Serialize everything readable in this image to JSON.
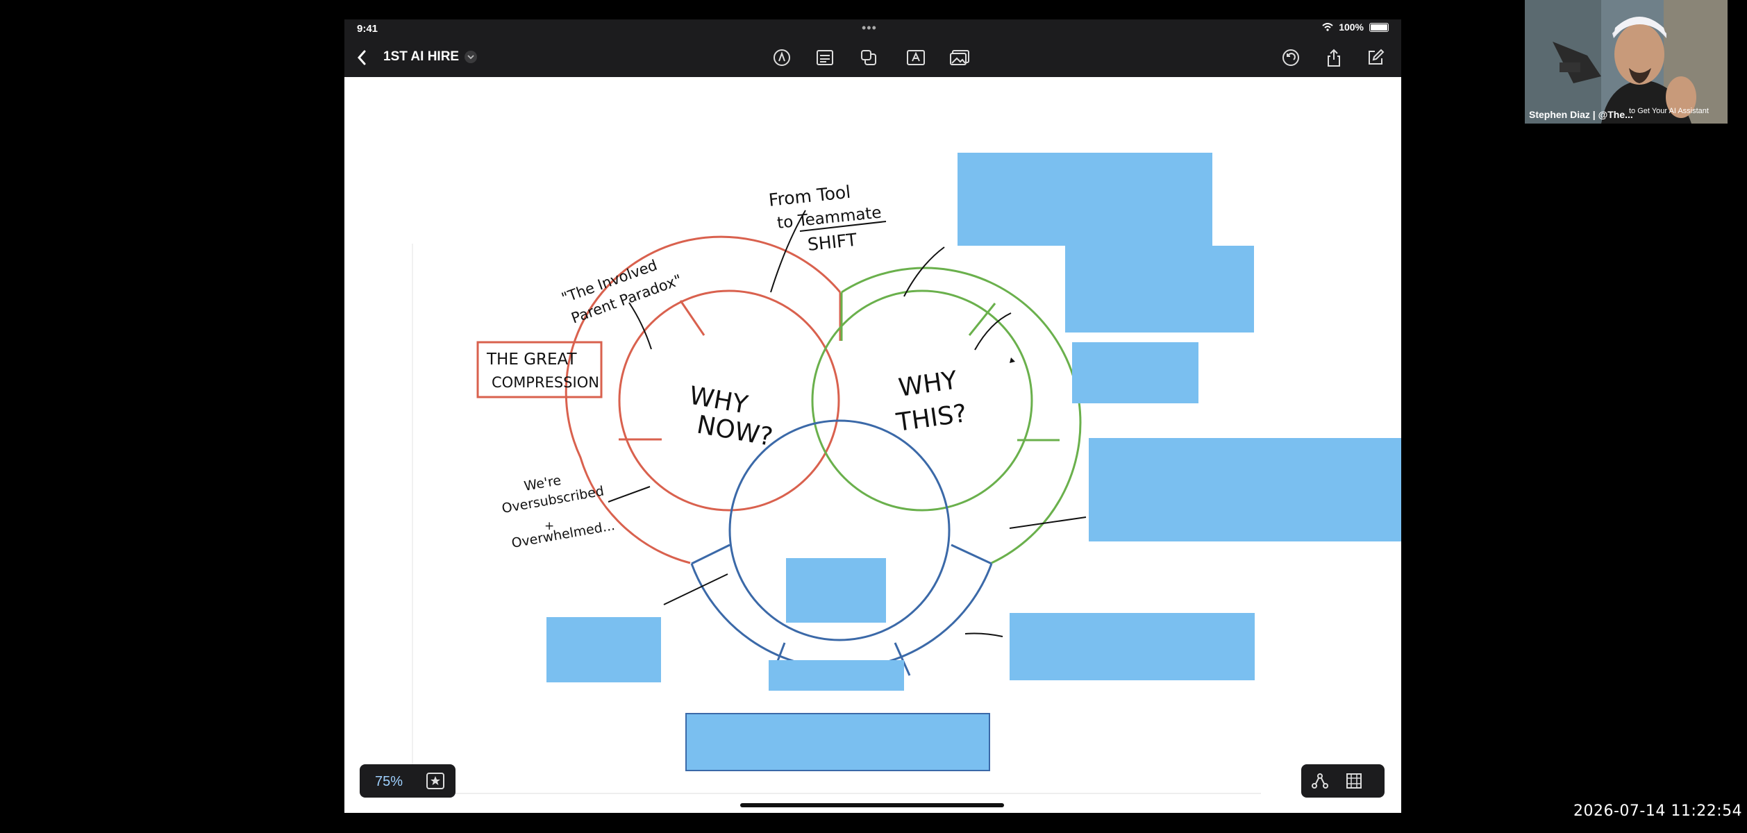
{
  "status": {
    "time": "9:41",
    "battery": "100%"
  },
  "toolbar": {
    "title": "1ST AI HIRE"
  },
  "diagram": {
    "label_tool_1": "From Tool",
    "label_tool_2": "to Teammate",
    "label_tool_3": "SHIFT",
    "label_parent_1": "\"The Involved",
    "label_parent_2": "Parent  Paradox\"",
    "label_compression_1": "THE GREAT",
    "label_compression_2": "COMPRESSION",
    "label_why_now_1": "WHY",
    "label_why_now_2": "NOW?",
    "label_why_this_1": "WHY",
    "label_why_this_2": "THIS?",
    "label_over_1": "We're",
    "label_over_2": "Oversubscribed",
    "label_over_3": "+",
    "label_over_4": "Overwhelmed..."
  },
  "zoom": {
    "value": "75%"
  },
  "recording": {
    "timestamp": "2026-07-14 11:22:54"
  },
  "webcam": {
    "name": "Stephen Diaz | @The...",
    "overlay": "to Get Your AI Assistant"
  },
  "colors": {
    "red": "#d9614e",
    "green": "#6ab04c",
    "blue": "#3b69a8",
    "redaction": "#7abff0"
  }
}
